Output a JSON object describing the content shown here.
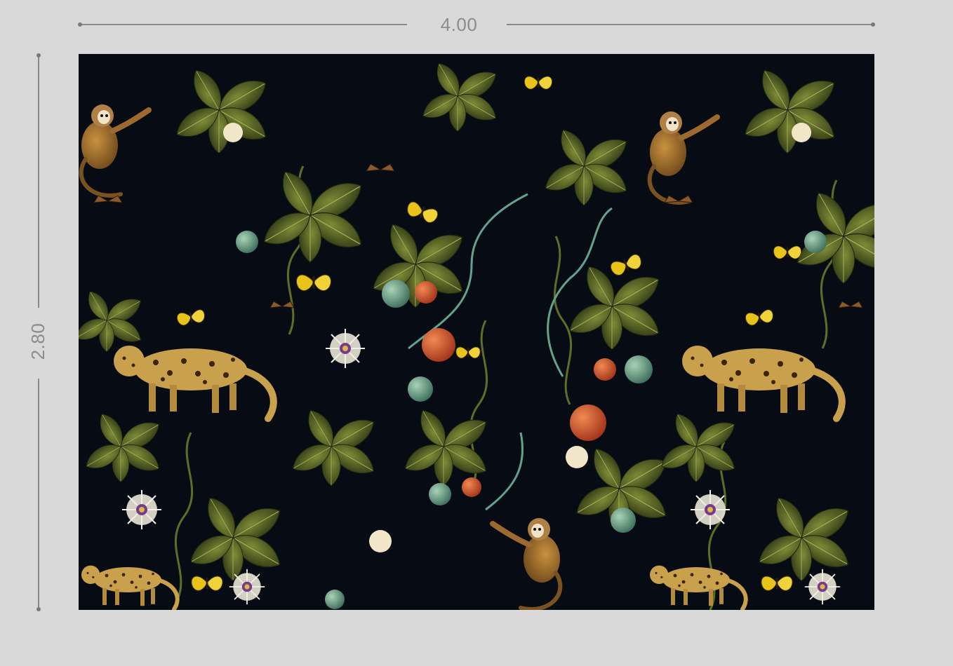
{
  "dimensions": {
    "width_label": "4.00",
    "height_label": "2.80"
  },
  "colors": {
    "page_background": "#d9d9d9",
    "dimension_line": "#8a8a8a",
    "pattern_background": "#070b14",
    "leaf_dark": "#3f4a1c",
    "leaf_light": "#6b7a2e",
    "fruit_red": "#c8502a",
    "fruit_teal": "#6fa58a",
    "butterfly_yellow": "#e8c31a",
    "animal_brown": "#9c6a2e"
  },
  "pattern": {
    "motif_icons": [
      "jungle-leaf-icon",
      "monkey-icon",
      "leopard-icon",
      "butterfly-icon",
      "fruit-icon",
      "flower-icon"
    ]
  }
}
